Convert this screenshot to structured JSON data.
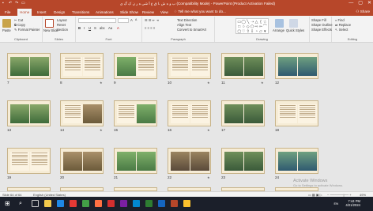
{
  "window": {
    "title": "ب و ه ش ،ا ق ع آ شی ه ر ن ک گ ی (Compatibility Mode) - PowerPoint (Product Activation Failed)",
    "controls": [
      "—",
      "▢",
      "✕"
    ]
  },
  "tabs": [
    {
      "label": "File",
      "active": false
    },
    {
      "label": "Home",
      "active": true
    },
    {
      "label": "Insert",
      "active": false
    },
    {
      "label": "Design",
      "active": false
    },
    {
      "label": "Transitions",
      "active": false
    },
    {
      "label": "Animations",
      "active": false
    },
    {
      "label": "Slide Show",
      "active": false
    },
    {
      "label": "Review",
      "active": false
    },
    {
      "label": "View",
      "active": false
    }
  ],
  "tell_me": "Tell me what you want to do...",
  "share": "Share",
  "ribbon": {
    "clipboard": {
      "paste": "Paste",
      "cut": "Cut",
      "copy": "Copy",
      "format_painter": "Format Painter",
      "label": "Clipboard"
    },
    "slides": {
      "new_slide": "New Slide",
      "layout": "Layout",
      "reset": "Reset",
      "section": "Section",
      "label": "Slides"
    },
    "font": {
      "label": "Font",
      "bold": "B",
      "italic": "I",
      "underline": "U",
      "strike": "S",
      "spacing": "abc",
      "case": "Aa",
      "grow": "A",
      "shrink": "A"
    },
    "paragraph": {
      "label": "Paragraph",
      "text_direction": "Text Direction",
      "align_text": "Align Text",
      "smartart": "Convert to SmartArt"
    },
    "drawing": {
      "label": "Drawing",
      "arrange": "Arrange",
      "quick_styles": "Quick Styles",
      "shape_fill": "Shape Fill",
      "shape_outline": "Shape Outline",
      "shape_effects": "Shape Effects"
    },
    "editing": {
      "label": "Editing",
      "find": "Find",
      "replace": "Replace",
      "select": "Select"
    }
  },
  "slides": [
    {
      "num": "7",
      "star": false
    },
    {
      "num": "8",
      "star": true
    },
    {
      "num": "9",
      "star": false
    },
    {
      "num": "10",
      "star": true
    },
    {
      "num": "11",
      "star": true
    },
    {
      "num": "12",
      "star": false
    },
    {
      "num": "13",
      "star": false
    },
    {
      "num": "14",
      "star": true
    },
    {
      "num": "15",
      "star": false
    },
    {
      "num": "16",
      "star": true
    },
    {
      "num": "17",
      "star": false
    },
    {
      "num": "18",
      "star": false
    },
    {
      "num": "19",
      "star": false
    },
    {
      "num": "20",
      "star": false
    },
    {
      "num": "21",
      "star": false
    },
    {
      "num": "22",
      "star": true
    },
    {
      "num": "23",
      "star": false
    },
    {
      "num": "24",
      "star": false
    }
  ],
  "status": {
    "slide": "Slide 64 of 64",
    "language": "English (United States)",
    "zoom": "49%"
  },
  "watermark": {
    "title": "Activate Windows",
    "subtitle": "Go to Settings to activate Windows."
  },
  "taskbar": {
    "time": "7:44 PM",
    "date": "4/21/2024",
    "lang": "EN"
  },
  "colors": {
    "accent": "#b7472a",
    "ribbon": "#f3f3f3",
    "sorter": "#e6e6e6",
    "taskbar": "#1b1f2a"
  }
}
